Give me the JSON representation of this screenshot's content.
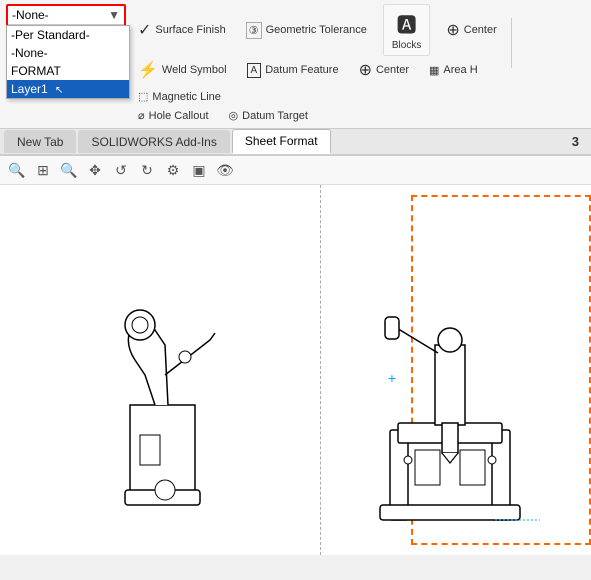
{
  "ribbon": {
    "layer_dropdown": {
      "current_value": "-None-",
      "items": [
        {
          "label": "-Per Standard-",
          "value": "per_standard"
        },
        {
          "label": "-None-",
          "value": "none"
        },
        {
          "label": "FORMAT",
          "value": "FORMAT"
        },
        {
          "label": "Layer1",
          "value": "Layer1",
          "selected": true
        }
      ]
    },
    "tools": [
      {
        "name": "surface-finish",
        "icon": "✓",
        "label": "Surface Finish"
      },
      {
        "name": "geometric-tolerance",
        "icon": "⬚③",
        "label": "Geometric Tolerance"
      },
      {
        "name": "weld-symbol",
        "icon": "⚡",
        "label": "Weld Symbol"
      },
      {
        "name": "datum-feature",
        "icon": "◻A",
        "label": "Datum Feature"
      },
      {
        "name": "datum-target",
        "icon": "◎A1",
        "label": "Datum Target"
      }
    ],
    "blocks_label": "Blocks",
    "center_label1": "Center",
    "center_label2": "Center",
    "area_h_label": "Area H",
    "magnetic_line_label": "Magnetic Line",
    "hole_callout_label": "Hole Callout"
  },
  "tabs": [
    {
      "label": "New Tab",
      "active": false
    },
    {
      "label": "SOLIDWORKS Add-Ins",
      "active": false
    },
    {
      "label": "Sheet Format",
      "active": true
    }
  ],
  "tab_number": "3",
  "toolbar": {
    "icons": [
      "🔍",
      "⊞",
      "🔍",
      "⊕",
      "↺",
      "↻",
      "⚙",
      "▣",
      "👁"
    ]
  },
  "drawing": {
    "has_dashed_border": true,
    "has_vertical_divider": true
  }
}
